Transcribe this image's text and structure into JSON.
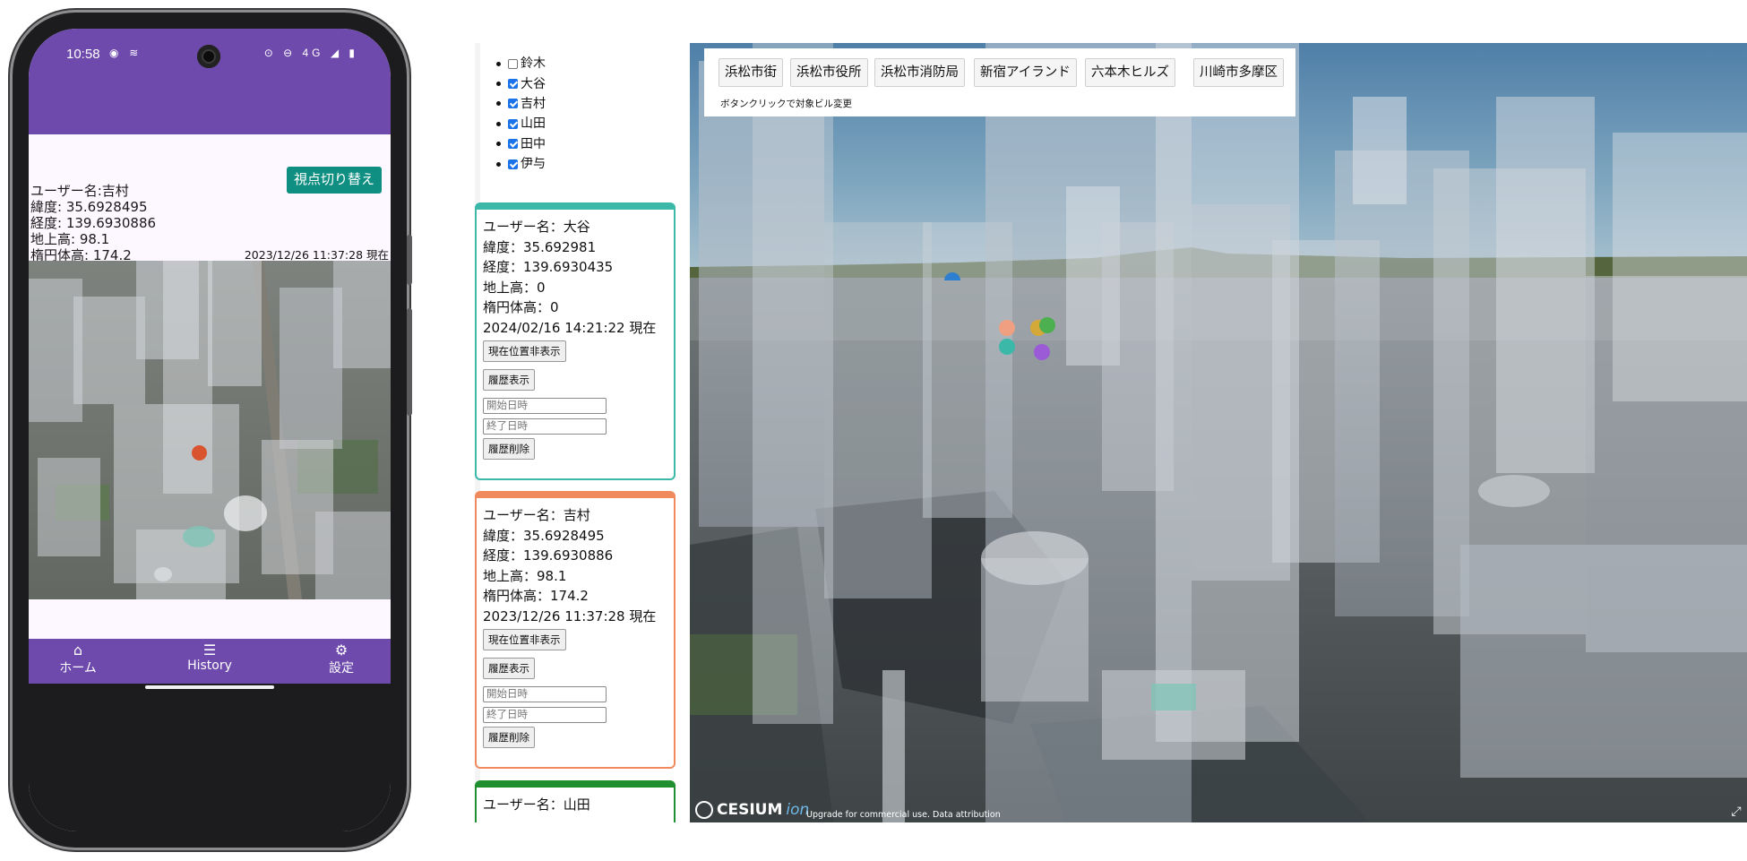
{
  "phone": {
    "status": {
      "time": "10:58",
      "left_icons": "◉ ≋",
      "right_icons": "⊙ ⊖ 4G ◢ ▮"
    },
    "info": {
      "username": "ユーザー名:吉村",
      "latitude": "緯度: 35.6928495",
      "longitude": "経度: 139.6930886",
      "ground_height": "地上高: 98.1",
      "ellipsoid_height": "楕円体高: 174.2",
      "timestamp": "2023/12/26 11:37:28 現在"
    },
    "switch_view_label": "視点切り替え",
    "nav": [
      {
        "label": "ホーム",
        "icon": "home-icon"
      },
      {
        "label": "History",
        "icon": "list-icon"
      },
      {
        "label": "設定",
        "icon": "gear-icon"
      }
    ],
    "marker_color": "#d9542e"
  },
  "web": {
    "user_list": [
      {
        "name": "鈴木",
        "checked": false
      },
      {
        "name": "大谷",
        "checked": true
      },
      {
        "name": "吉村",
        "checked": true
      },
      {
        "name": "山田",
        "checked": true
      },
      {
        "name": "田中",
        "checked": true
      },
      {
        "name": "伊与",
        "checked": true
      }
    ],
    "cards": [
      {
        "color": "#3bb8a8",
        "username": "ユーザー名：大谷",
        "latitude": "緯度：35.692981",
        "longitude": "経度：139.6930435",
        "ground_height": "地上高：0",
        "ellipsoid_height": "楕円体高：0",
        "timestamp": "2024/02/16 14:21:22 現在",
        "hide_location_label": "現在位置非表示",
        "show_history_label": "履歴表示",
        "start_placeholder": "開始日時",
        "end_placeholder": "終了日時",
        "delete_history_label": "履歴削除"
      },
      {
        "color": "#f08a5d",
        "username": "ユーザー名：吉村",
        "latitude": "緯度：35.6928495",
        "longitude": "経度：139.6930886",
        "ground_height": "地上高：98.1",
        "ellipsoid_height": "楕円体高：174.2",
        "timestamp": "2023/12/26 11:37:28 現在",
        "hide_location_label": "現在位置非表示",
        "show_history_label": "履歴表示",
        "start_placeholder": "開始日時",
        "end_placeholder": "終了日時",
        "delete_history_label": "履歴削除"
      },
      {
        "color": "#1f8f2f",
        "username": "ユーザー名：山田"
      }
    ],
    "toolbar": {
      "buttons": [
        "浜松市街",
        "浜松市役所",
        "浜松市消防局",
        "新宿アイランド",
        "六本木ヒルズ",
        "川崎市多摩区"
      ],
      "note": "ボタンクリックで対象ビル変更"
    },
    "viewer": {
      "logo_text": "CESIUM",
      "logo_suffix": "ion",
      "attribution": "Upgrade for commercial use. Data attribution",
      "markers": [
        {
          "color": "#f0a080"
        },
        {
          "color": "#d4a93a"
        },
        {
          "color": "#4caf50"
        },
        {
          "color": "#3bb8a8"
        },
        {
          "color": "#9b5bd6"
        },
        {
          "color": "#2f7fd0"
        }
      ]
    }
  }
}
